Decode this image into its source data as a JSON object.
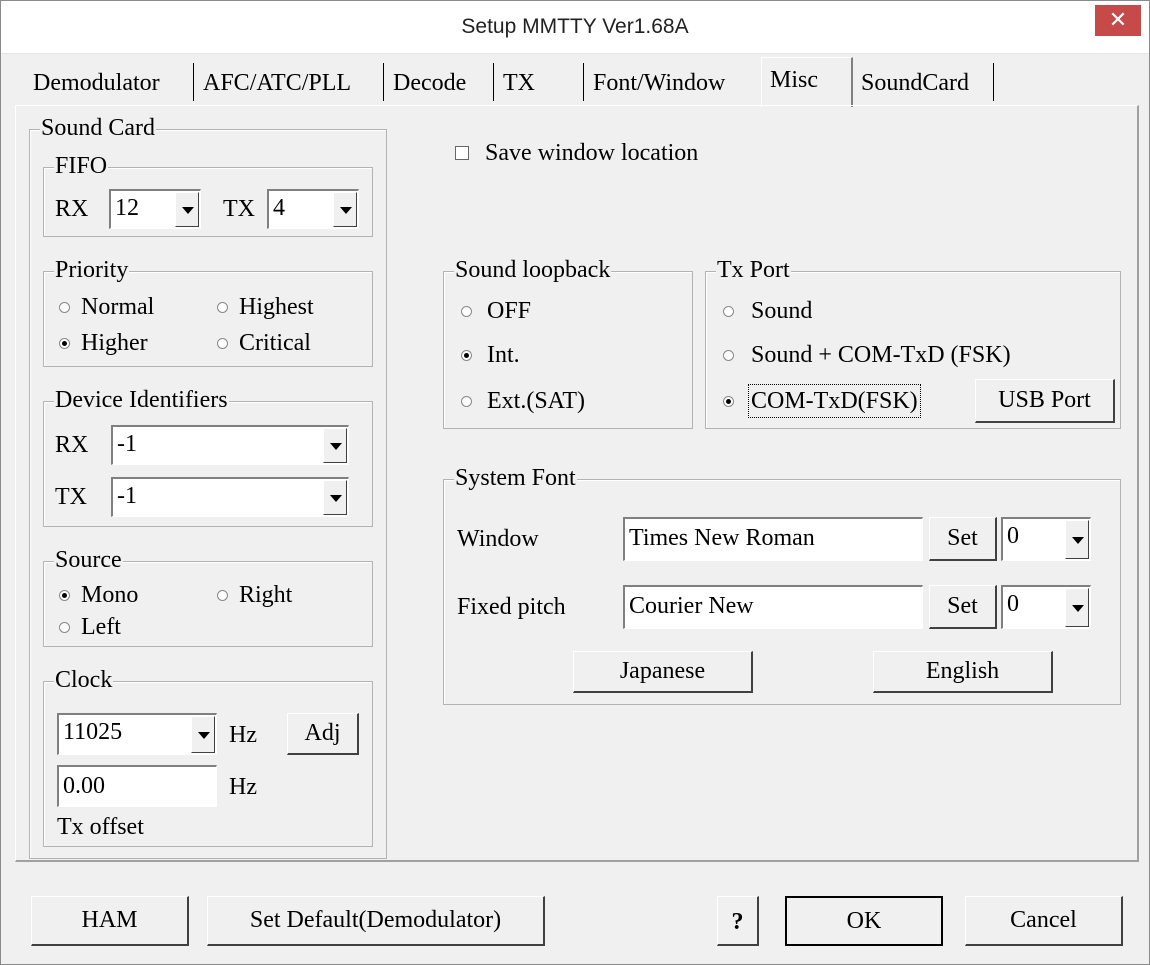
{
  "window": {
    "title": "Setup MMTTY Ver1.68A",
    "close_glyph": "✕"
  },
  "tabs": [
    {
      "label": "Demodulator"
    },
    {
      "label": "AFC/ATC/PLL"
    },
    {
      "label": "Decode"
    },
    {
      "label": "TX"
    },
    {
      "label": "Font/Window"
    },
    {
      "label": "Misc",
      "active": true
    },
    {
      "label": "SoundCard"
    }
  ],
  "sound_card": {
    "label": "Sound Card",
    "fifo": {
      "label": "FIFO",
      "rx_label": "RX",
      "rx_value": "12",
      "tx_label": "TX",
      "tx_value": "4"
    },
    "priority": {
      "label": "Priority",
      "options": [
        "Normal",
        "Highest",
        "Higher",
        "Critical"
      ],
      "selected": "Higher"
    },
    "device_identifiers": {
      "label": "Device Identifiers",
      "rx_label": "RX",
      "rx_value": "-1",
      "tx_label": "TX",
      "tx_value": "-1"
    },
    "source": {
      "label": "Source",
      "options": [
        "Mono",
        "Right",
        "Left"
      ],
      "selected": "Mono"
    },
    "clock": {
      "label": "Clock",
      "rate_value": "11025",
      "hz_label": "Hz",
      "adj_label": "Adj",
      "offset_value": "0.00",
      "hz_label2": "Hz",
      "tx_offset_label": "Tx offset"
    }
  },
  "save_window_location": {
    "label": "Save window location",
    "checked": false
  },
  "sound_loopback": {
    "label": "Sound loopback",
    "options": [
      "OFF",
      "Int.",
      "Ext.(SAT)"
    ],
    "selected": "Int."
  },
  "tx_port": {
    "label": "Tx Port",
    "options": [
      "Sound",
      "Sound + COM-TxD (FSK)",
      "COM-TxD(FSK)"
    ],
    "selected": "COM-TxD(FSK)",
    "usb_port_label": "USB Port"
  },
  "system_font": {
    "label": "System Font",
    "window_label": "Window",
    "window_font": "Times New Roman",
    "window_set": "Set",
    "window_size": "0",
    "fixed_label": "Fixed pitch",
    "fixed_font": "Courier New",
    "fixed_set": "Set",
    "fixed_size": "0",
    "japanese_label": "Japanese",
    "english_label": "English"
  },
  "footer": {
    "ham_label": "HAM",
    "set_default_label": "Set Default(Demodulator)",
    "help_label": "?",
    "ok_label": "OK",
    "cancel_label": "Cancel"
  }
}
